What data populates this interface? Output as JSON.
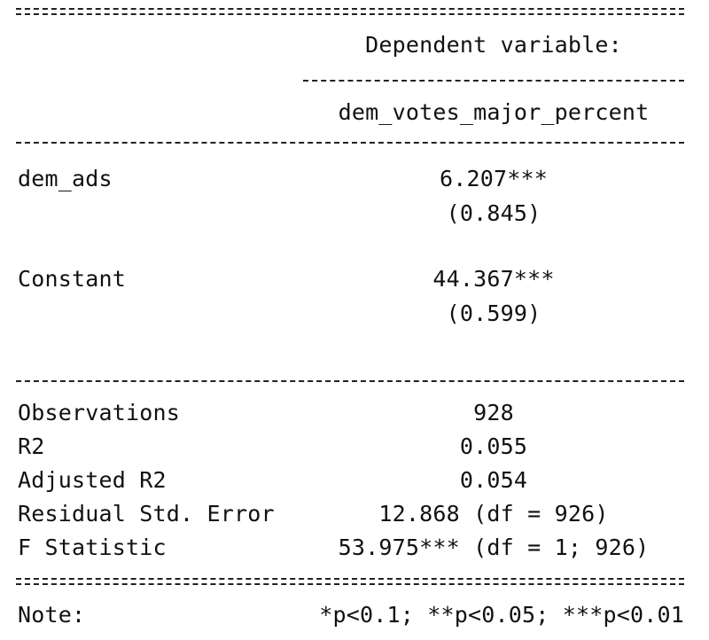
{
  "header": {
    "dependent_label": "Dependent variable:",
    "dependent_name": "dem_votes_major_percent"
  },
  "coefficients": [
    {
      "name": "dem_ads",
      "estimate": "6.207***",
      "se": "(0.845)"
    },
    {
      "name": "Constant",
      "estimate": "44.367***",
      "se": "(0.599)"
    }
  ],
  "stats": [
    {
      "name": "Observations",
      "value": "928"
    },
    {
      "name": "R2",
      "value": "0.055"
    },
    {
      "name": "Adjusted R2",
      "value": "0.054"
    },
    {
      "name": "Residual Std. Error",
      "value": "12.868 (df = 926)"
    },
    {
      "name": "F Statistic",
      "value": "53.975*** (df = 1; 926)"
    }
  ],
  "note": {
    "label": "Note:",
    "text": "*p<0.1; **p<0.05; ***p<0.01"
  }
}
